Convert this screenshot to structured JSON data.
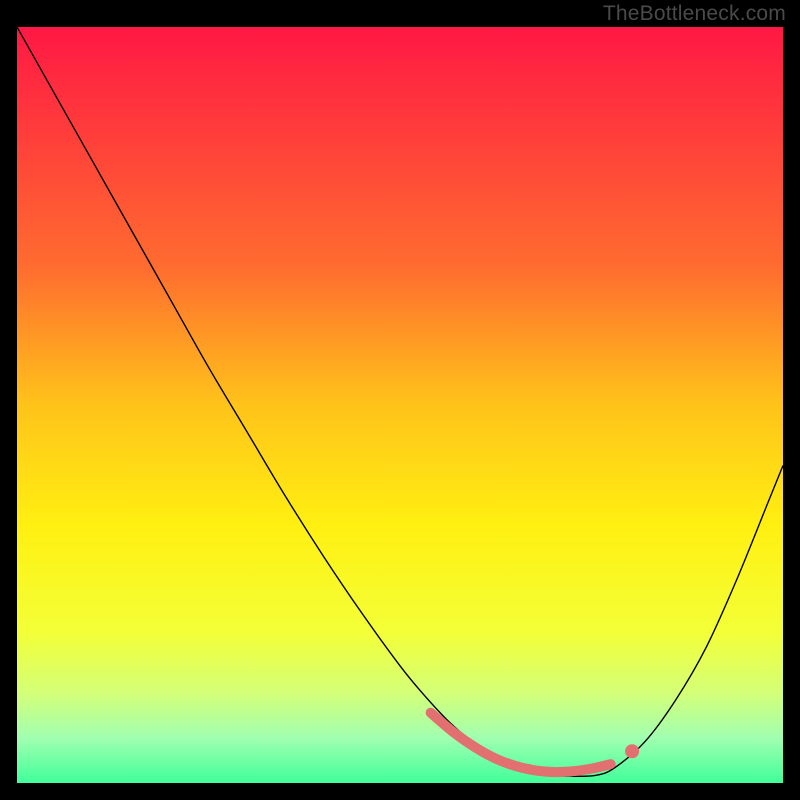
{
  "watermark": "TheBottleneck.com",
  "chart_data": {
    "type": "line",
    "title": "",
    "xlabel": "",
    "ylabel": "",
    "xlim": [
      0,
      100
    ],
    "ylim": [
      0,
      100
    ],
    "grid": false,
    "legend": false,
    "background": {
      "type": "vertical_gradient",
      "stops": [
        {
          "pos": 0,
          "color": "#ff1844"
        },
        {
          "pos": 32,
          "color": "#ff6d2f"
        },
        {
          "pos": 50,
          "color": "#ffc31a"
        },
        {
          "pos": 66,
          "color": "#fff011"
        },
        {
          "pos": 80,
          "color": "#f3ff37"
        },
        {
          "pos": 88,
          "color": "#d4ff77"
        },
        {
          "pos": 94,
          "color": "#a1ffb0"
        },
        {
          "pos": 100,
          "color": "#40ff9a"
        }
      ]
    },
    "series": [
      {
        "name": "bottleneck-curve",
        "type": "line",
        "color": "#000000",
        "width": 1.4,
        "x": [
          0,
          5,
          10,
          15,
          20,
          25,
          30,
          35,
          40,
          45,
          50,
          53,
          56.5,
          60,
          63,
          66,
          69,
          72,
          75.5,
          78,
          82,
          86,
          90,
          94,
          98,
          100
        ],
        "y": [
          100,
          91,
          82,
          73,
          64,
          55,
          46.5,
          38,
          30,
          22.5,
          15.5,
          11.8,
          8,
          5,
          3,
          1.7,
          1.0,
          0.9,
          1.0,
          2.0,
          5.5,
          11,
          18,
          27,
          37,
          42
        ]
      },
      {
        "name": "highlight-band",
        "type": "line",
        "color": "#e27070",
        "width": 10,
        "linecap": "round",
        "x": [
          54,
          57,
          60,
          63,
          66,
          69,
          72,
          75,
          77.5
        ],
        "y": [
          9.3,
          6.7,
          4.6,
          3.0,
          2.0,
          1.5,
          1.5,
          1.9,
          2.5
        ]
      },
      {
        "name": "highlight-dot",
        "type": "scatter",
        "color": "#e27070",
        "radius": 7,
        "x": [
          80.3
        ],
        "y": [
          4.2
        ]
      }
    ]
  }
}
